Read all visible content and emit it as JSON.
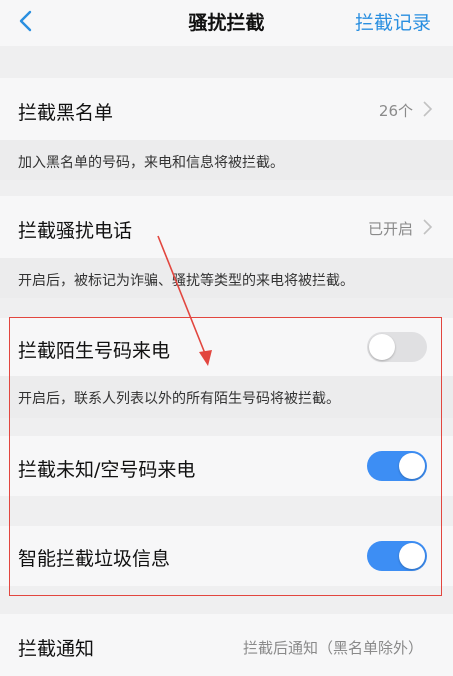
{
  "header": {
    "title": "骚扰拦截",
    "action": "拦截记录"
  },
  "blacklist": {
    "title": "拦截黑名单",
    "count": "26个",
    "desc": "加入黑名单的号码，来电和信息将被拦截。"
  },
  "harass_call": {
    "title": "拦截骚扰电话",
    "status": "已开启",
    "desc": "开启后，被标记为诈骗、骚扰等类型的来电将被拦截。"
  },
  "stranger_call": {
    "title": "拦截陌生号码来电",
    "enabled": false,
    "desc": "开启后，联系人列表以外的所有陌生号码将被拦截。"
  },
  "unknown_call": {
    "title": "拦截未知/空号码来电",
    "enabled": true
  },
  "spam_sms": {
    "title": "智能拦截垃圾信息",
    "enabled": true
  },
  "notify": {
    "title": "拦截通知",
    "value": "拦截后通知（黑名单除外）"
  },
  "colors": {
    "accent": "#3d8ef4",
    "link": "#2a8fe0",
    "annotation": "#e2463f"
  }
}
